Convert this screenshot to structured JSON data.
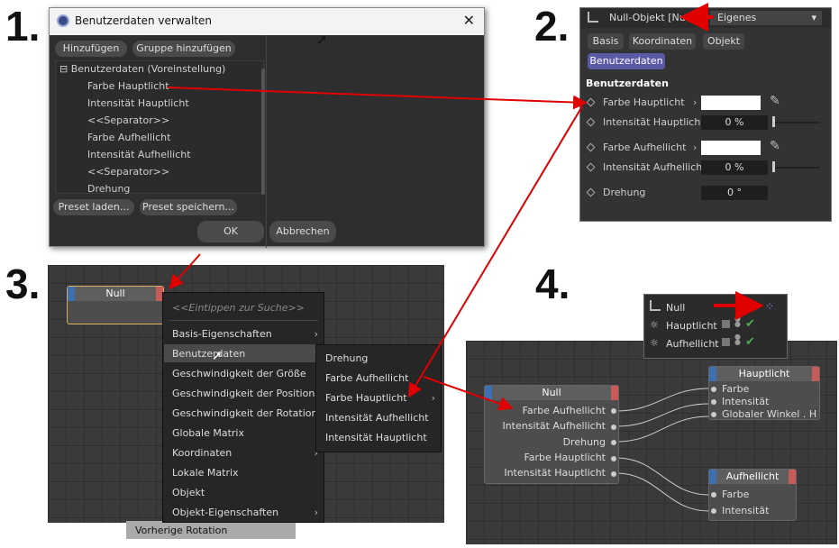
{
  "labels": {
    "n1": "1.",
    "n2": "2.",
    "n3": "3.",
    "n4": "4."
  },
  "dialog": {
    "title": "Benutzerdaten verwalten",
    "add": "Hinzufügen",
    "add_group": "Gruppe hinzufügen",
    "tree_root": "Benutzerdaten (Voreinstellung)",
    "items": [
      "Farbe Hauptlicht",
      "Intensität Hauptlicht",
      "<<Separator>>",
      "Farbe Aufhellicht",
      "Intensität Aufhellicht",
      "<<Separator>>",
      "Drehung"
    ],
    "preset_load": "Preset laden...",
    "preset_save": "Preset speichern...",
    "ok": "OK",
    "cancel": "Abbrechen"
  },
  "attr": {
    "object": "Null-Objekt [Null]",
    "mode": "Eigenes",
    "tabs": [
      "Basis",
      "Koordinaten",
      "Objekt"
    ],
    "active_tab": "Benutzerdaten",
    "section": "Benutzerdaten",
    "rows": [
      {
        "label": "Farbe Hauptlicht"
      },
      {
        "label": "Intensität Hauptlicht",
        "value": "0 %"
      },
      {
        "label": "Farbe Aufhellicht"
      },
      {
        "label": "Intensität Aufhellicht",
        "value": "0 %"
      },
      {
        "label": "Drehung",
        "value": "0 °"
      }
    ]
  },
  "xpresso3": {
    "node": "Null",
    "search": "<<Eintippen zur Suche>>",
    "menu": [
      "Basis-Eigenschaften",
      "Benutzerdaten",
      "Geschwindigkeit der Größe",
      "Geschwindigkeit der Position",
      "Geschwindigkeit der Rotation",
      "Globale Matrix",
      "Koordinaten",
      "Lokale Matrix",
      "Objekt",
      "Objekt-Eigenschaften"
    ],
    "submenu": [
      "Drehung",
      "Farbe Aufhellicht",
      "Farbe Hauptlicht",
      "Intensität Aufhellicht",
      "Intensität Hauptlicht"
    ],
    "behind": "Vorherige Rotation"
  },
  "objects": {
    "items": [
      "Null",
      "Hauptlicht",
      "Aufhellicht"
    ]
  },
  "xpresso4": {
    "null_title": "Null",
    "null_ports": [
      "Farbe Aufhellicht",
      "Intensität Aufhellicht",
      "Drehung",
      "Farbe Hauptlicht",
      "Intensität Hauptlicht"
    ],
    "haupt_title": "Hauptlicht",
    "haupt_ports": [
      "Farbe",
      "Intensität",
      "Globaler Winkel . H"
    ],
    "auf_title": "Aufhellicht",
    "auf_ports": [
      "Farbe",
      "Intensität"
    ]
  },
  "colors": {
    "arrow": "#e00000",
    "port_in": "#3e6fb3",
    "port_out": "#c85a5a",
    "active_tab": "#5a5aa8"
  }
}
